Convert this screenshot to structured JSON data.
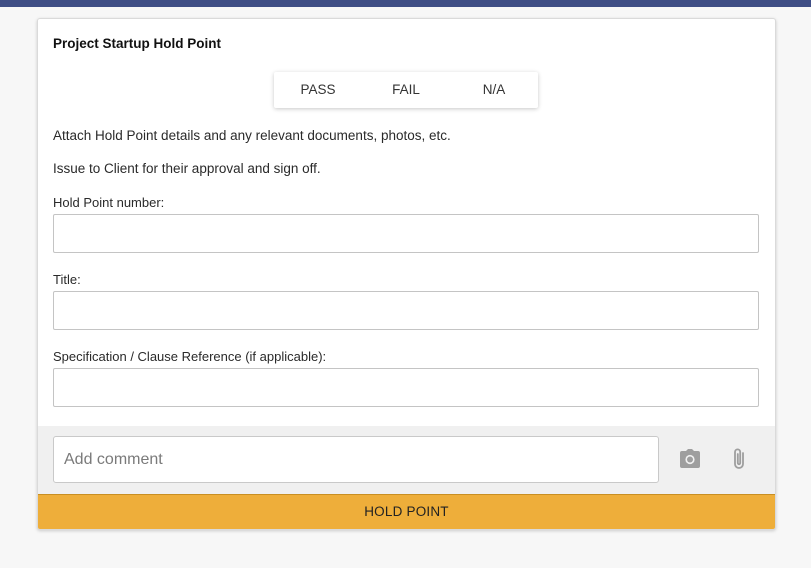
{
  "section": {
    "title": "Project Startup Hold Point"
  },
  "result_options": [
    "PASS",
    "FAIL",
    "N/A"
  ],
  "instructions": [
    "Attach Hold Point details and any relevant documents, photos, etc.",
    "Issue to Client for their approval and sign off."
  ],
  "fields": [
    {
      "label": "Hold Point number:",
      "value": ""
    },
    {
      "label": "Title:",
      "value": ""
    },
    {
      "label": "Specification / Clause Reference (if applicable):",
      "value": ""
    }
  ],
  "comment": {
    "placeholder": "Add comment",
    "value": "",
    "icons": [
      "camera-icon",
      "paperclip-icon"
    ]
  },
  "action_button": {
    "label": "HOLD POINT"
  },
  "colors": {
    "top_bar": "#3f4e85",
    "action_button": "#eeae3a"
  }
}
